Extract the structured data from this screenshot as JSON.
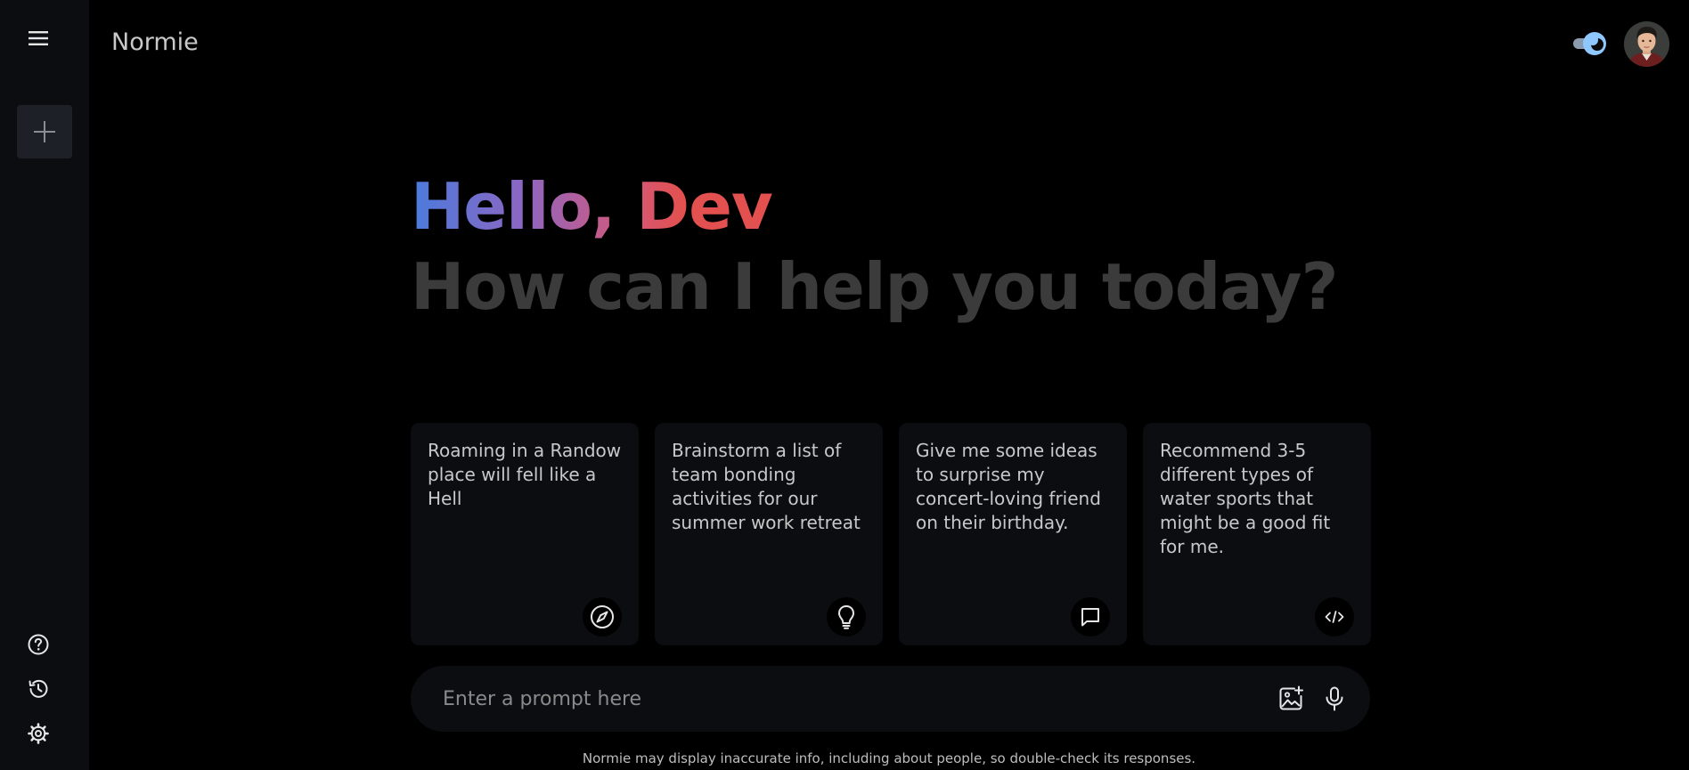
{
  "header": {
    "app_title": "Normie"
  },
  "sidebar": {
    "menu_icon": "hamburger-icon",
    "new_chat_icon": "plus-icon",
    "bottom_icons": [
      "help-icon",
      "history-icon",
      "settings-icon"
    ]
  },
  "greeting": {
    "hello": "Hello, Dev",
    "subtitle": "How can I help you today?"
  },
  "cards": [
    {
      "text": "Roaming in a Randow place will fell like a Hell",
      "icon": "compass-icon"
    },
    {
      "text": "Brainstorm a list of team bonding activities for our summer work retreat",
      "icon": "lightbulb-icon"
    },
    {
      "text": "Give me some ideas to surprise my concert-loving friend on their birthday.",
      "icon": "message-icon"
    },
    {
      "text": "Recommend 3-5 different types of water sports that might be a good fit for me.",
      "icon": "code-icon"
    }
  ],
  "prompt": {
    "placeholder": "Enter a prompt here",
    "value": ""
  },
  "disclaimer": "Normie may display inaccurate info, including about people, so double-check its responses.",
  "colors": {
    "background": "#000000",
    "sidebar": "#0b0d11",
    "card": "#0b0d11",
    "greeting_start": "#4a7bdc",
    "greeting_end": "#e2514f",
    "subtitle": "#3b3b3b",
    "toggle_accent": "#8fc7ff"
  }
}
